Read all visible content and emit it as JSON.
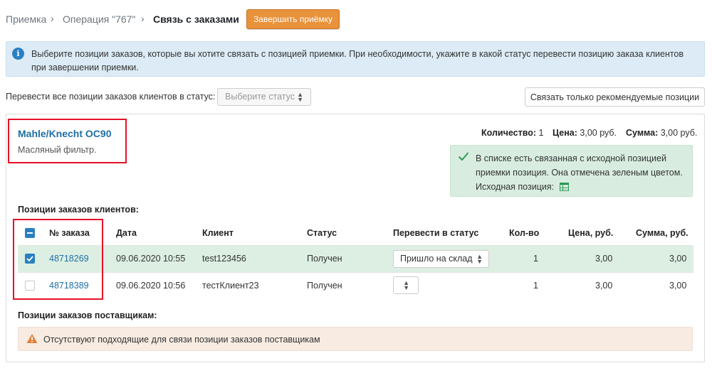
{
  "breadcrumb": {
    "items": [
      "Приемка",
      "Операция \"767\"",
      "Связь с заказами"
    ],
    "separator": "›"
  },
  "header": {
    "finish_button": "Завершить приёмку"
  },
  "info_message": "Выберите позиции заказов, которые вы хотите связать с позицией приемки. При необходимости, укажите в какой статус перевести позицию заказа клиентов при завершении приемки.",
  "bulk_status": {
    "label": "Перевести все позиции заказов клиентов в статус:",
    "placeholder": "Выберите статус"
  },
  "link_recommended_button": "Связать только рекомендуемые позиции",
  "product": {
    "name": "Mahle/Knecht OC90",
    "description": "Масляный фильтр.",
    "quantity_label": "Количество:",
    "quantity_value": "1",
    "price_label": "Цена:",
    "price_value": "3,00 руб.",
    "sum_label": "Сумма:",
    "sum_value": "3,00 руб."
  },
  "success_message": {
    "text": "В списке есть связанная с исходной позицией приемки позиция. Она отмечена зеленым цветом.",
    "source_label": "Исходная позиция:"
  },
  "client_orders": {
    "title": "Позиции заказов клиентов:",
    "columns": [
      "№ заказа",
      "Дата",
      "Клиент",
      "Статус",
      "Перевести в статус",
      "Кол-во",
      "Цена, руб.",
      "Сумма, руб."
    ],
    "rows": [
      {
        "checked": true,
        "order": "48718269",
        "date": "09.06.2020 10:55",
        "client": "test123456",
        "status": "Получен",
        "to_status": "Пришло на склад",
        "qty": "1",
        "price": "3,00",
        "sum": "3,00"
      },
      {
        "checked": false,
        "order": "48718389",
        "date": "09.06.2020 10:56",
        "client": "тестКлиент23",
        "status": "Получен",
        "to_status": "",
        "qty": "1",
        "price": "3,00",
        "sum": "3,00"
      }
    ]
  },
  "supplier_orders": {
    "title": "Позиции заказов поставщикам:",
    "warning": "Отсутствуют подходящие для связи позиции заказов поставщикам"
  },
  "colors": {
    "accent": "#2a7fc0",
    "link": "#1f6fa5",
    "orange_button": "#e8923a",
    "info_bg": "#dcebf5",
    "success_bg": "#d8ede0",
    "warning_bg": "#f8ece2",
    "highlight_row": "#ddefe3",
    "annotation_red": "#e8102a"
  },
  "icons": {
    "info": "info-icon",
    "success": "check-icon",
    "source": "spreadsheet-icon",
    "warning": "warning-icon",
    "select": "sort-arrows-icon"
  }
}
